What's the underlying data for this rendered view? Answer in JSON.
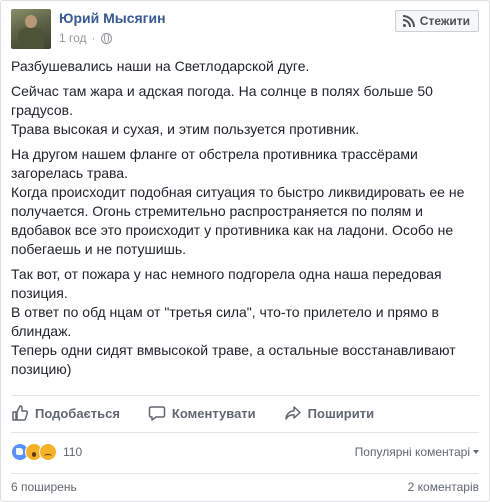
{
  "header": {
    "author": "Юрий Мысягин",
    "time": "1 год",
    "follow_label": "Стежити"
  },
  "post": {
    "paragraphs": [
      "Разбушевались наши на Светлодарской дуге.",
      "Сейчас там жара и адская погода. На солнце в полях больше 50\nградусов.\nТрава высокая и сухая, и этим пользуется противник.",
      "На другом нашем фланге от обстрела противника трассёрами\nзагорелась трава.\nКогда происходит подобная ситуация то быстро ликвидировать ее не\nполучается. Огонь стремительно распространяется по полям и\nвдобавок все это происходит у противника как на ладони. Особо не\nпобегаешь и не потушишь.",
      "Так вот, от пожара у нас немного подгорела одна наша передовая\nпозиция.\nВ ответ по обд        нцам от \"третья сила\", что-то прилетело и прямо в\nблиндаж.\nТеперь одни сидят вмвысокой траве, а остальные восстанавливают\nпозицию)"
    ]
  },
  "actions": {
    "like": "Подобається",
    "comment": "Коментувати",
    "share": "Поширити"
  },
  "reactions": {
    "icons": [
      "like-icon",
      "wow-icon",
      "sad-icon"
    ],
    "count": "110",
    "sort_label": "Популярні коментарі"
  },
  "footer": {
    "shares": "6 поширень",
    "comments": "2 коментарів"
  },
  "colors": {
    "link": "#365899",
    "secondary_text": "#90949c",
    "action_text": "#606770",
    "like": "#5890ff",
    "emoji": "#f7b125"
  }
}
